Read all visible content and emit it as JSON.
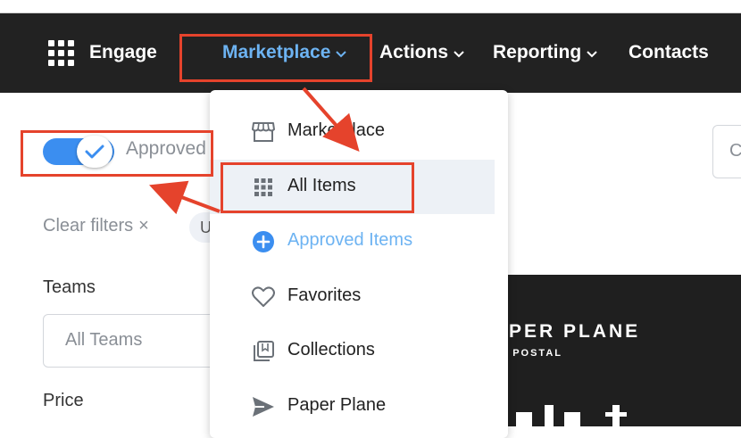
{
  "navbar": {
    "brand": "Engage",
    "items": [
      {
        "label": "Marketplace",
        "active": true
      },
      {
        "label": "Actions"
      },
      {
        "label": "Reporting"
      },
      {
        "label": "Contacts"
      }
    ]
  },
  "filters": {
    "approved_toggle_label": "Approved",
    "approved_toggle_on": true,
    "clear_filters": "Clear filters",
    "clear_icon": "×",
    "chip_text": "U",
    "teams_label": "Teams",
    "teams_value": "All Teams",
    "price_label": "Price"
  },
  "search": {
    "placeholder_fragment": "C"
  },
  "promo": {
    "title": "PER PLANE",
    "subtitle": "Y POSTAL"
  },
  "dropdown": {
    "items": [
      {
        "label": "Marketplace",
        "icon": "storefront-icon"
      },
      {
        "label": "All Items",
        "icon": "grid-icon",
        "highlighted": true
      },
      {
        "label": "Approved Items",
        "icon": "plus-circle-icon",
        "accent": true
      },
      {
        "label": "Favorites",
        "icon": "heart-icon"
      },
      {
        "label": "Collections",
        "icon": "collections-icon"
      },
      {
        "label": "Paper Plane",
        "icon": "paper-plane-icon"
      }
    ]
  },
  "colors": {
    "navbar_bg": "#222222",
    "accent_blue": "#6db3f2",
    "toggle_blue": "#3b8ef0",
    "annotation_red": "#e5432c"
  }
}
